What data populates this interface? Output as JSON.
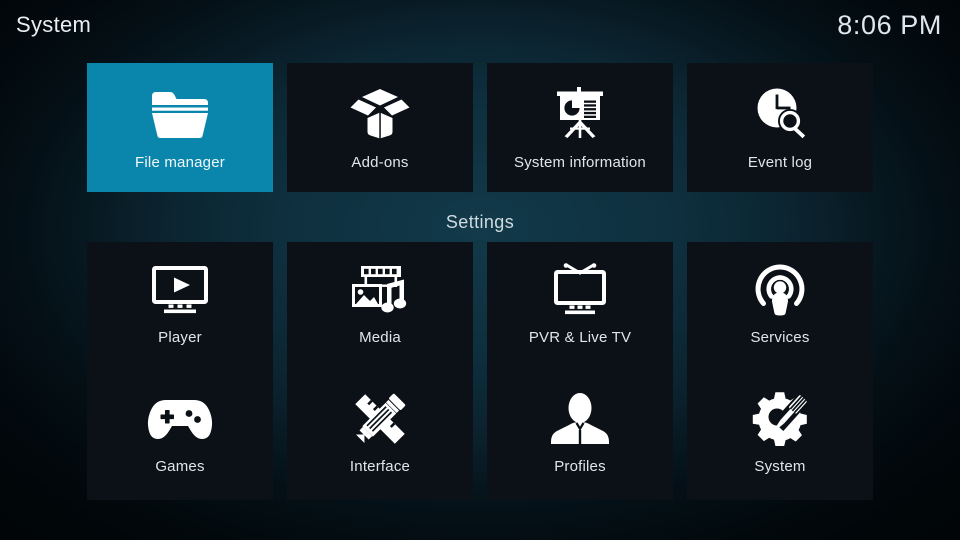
{
  "window": {
    "app": "Kodi",
    "screen_title": "System"
  },
  "topbar": {
    "title": "System",
    "clock": "8:06 PM"
  },
  "section": {
    "heading": "Settings"
  },
  "colors": {
    "selected_tile": "#0a86ac",
    "focus_border": "#cf3a26",
    "tile_background": "#0b1117",
    "page_background": "#0a212c",
    "text": "#dfe6ea"
  },
  "top_row": {
    "tiles": [
      {
        "label": "File manager",
        "icon": "folder-icon",
        "selected": true
      },
      {
        "label": "Add-ons",
        "icon": "open-box-icon",
        "selected": false
      },
      {
        "label": "System information",
        "icon": "presentation-icon",
        "selected": false
      },
      {
        "label": "Event log",
        "icon": "clock-search-icon",
        "selected": false
      }
    ]
  },
  "settings_rows": {
    "middle": [
      {
        "label": "Player",
        "icon": "monitor-play-icon"
      },
      {
        "label": "Media",
        "icon": "film-photo-music-icon"
      },
      {
        "label": "PVR & Live TV",
        "icon": "tv-antenna-icon"
      },
      {
        "label": "Services",
        "icon": "broadcast-person-icon"
      }
    ],
    "bottom": [
      {
        "label": "Games",
        "icon": "gamepad-icon"
      },
      {
        "label": "Interface",
        "icon": "pencil-ruler-icon"
      },
      {
        "label": "Profiles",
        "icon": "person-bust-icon"
      },
      {
        "label": "System",
        "icon": "gear-screwdriver-icon"
      }
    ]
  }
}
